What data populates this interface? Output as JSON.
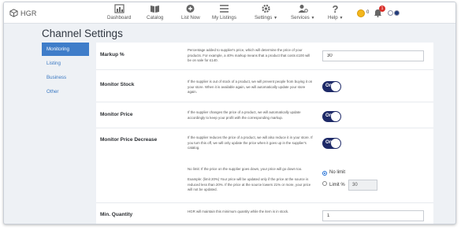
{
  "brand": {
    "logo_text": "HGR"
  },
  "nav": [
    {
      "label": "Dashboard",
      "icon": "dashboard-icon"
    },
    {
      "label": "Catalog",
      "icon": "book-icon"
    },
    {
      "label": "List Now",
      "icon": "plus-circle-icon"
    },
    {
      "label": "My Listings",
      "icon": "list-icon"
    },
    {
      "label": "Settings",
      "icon": "gear-icon"
    },
    {
      "label": "Services",
      "icon": "user-gear-icon"
    },
    {
      "label": "Help",
      "icon": "question-icon"
    }
  ],
  "status": {
    "coins": "0",
    "notifications": "1"
  },
  "page_title": "Channel Settings",
  "sidebar": {
    "items": [
      {
        "label": "Monitoring",
        "active": true
      },
      {
        "label": "Listing",
        "active": false
      },
      {
        "label": "Business",
        "active": false
      },
      {
        "label": "Other",
        "active": false
      }
    ]
  },
  "settings": {
    "markup": {
      "label": "Markup %",
      "description": "Percentage added to supplier's price, which will determine the price of your products. For example, a 40% markup means that a product that costs £100 will be on sale for £140.",
      "value": "30"
    },
    "monitor_stock": {
      "label": "Monitor Stock",
      "description": "If the supplier is out of stock of a product, we will prevent people from buying it on your store. When it is available again, we will automatically update your store again.",
      "toggle": "On"
    },
    "monitor_price": {
      "label": "Monitor Price",
      "description": "If the supplier changes the price of a product, we will automatically update accordingly to keep your profit with the corresponding markup.",
      "toggle": "On"
    },
    "monitor_price_decrease": {
      "label": "Monitor Price Decrease",
      "description": "If the supplier reduces the price of a product, we will also reduce it in your store. If you turn this off, we will only update the price when it goes up in the supplier's catalog.",
      "toggle": "On",
      "note": "No limit: If the price on the supplier goes down, your price will go down too.",
      "example": "Example: (limit 20%) Your price will be updated only if the price at the source is reduced less than 20%. If the price at the source lowers 21% or more, your price will not be updated.",
      "options": {
        "no_limit": "No limit",
        "limit": "Limit %"
      },
      "selected": "No limit",
      "limit_value": "30"
    },
    "min_quantity": {
      "label": "Min. Quantity",
      "description": "HGR will maintain this minimum quantity while the item is in stock.",
      "value": "1"
    }
  },
  "colors": {
    "accent": "#3f7dc9",
    "toggle": "#1e2a68",
    "background": "#eef1f5"
  }
}
